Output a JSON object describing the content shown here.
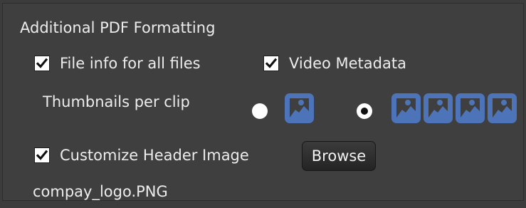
{
  "section": {
    "title": "Additional PDF Formatting"
  },
  "options": {
    "file_info_all_files": {
      "label": "File info for all files",
      "checked": true
    },
    "video_metadata": {
      "label": "Video Metadata",
      "checked": true
    },
    "customize_header_image": {
      "label": "Customize Header Image",
      "checked": true
    }
  },
  "thumbnails": {
    "label": "Thumbnails per clip",
    "choices": [
      {
        "selected": false,
        "icon": "image-icon",
        "count": 1
      },
      {
        "selected": true,
        "icon": "image-icon",
        "count": 4
      }
    ]
  },
  "header_image": {
    "browse_label": "Browse",
    "filename": "compay_logo.PNG"
  },
  "colors": {
    "panel_bg": "#3f3f3f",
    "text": "#ececec",
    "accent_blue": "#4d74b8",
    "checkbox_bg": "#ffffff",
    "check_mark": "#111111"
  }
}
